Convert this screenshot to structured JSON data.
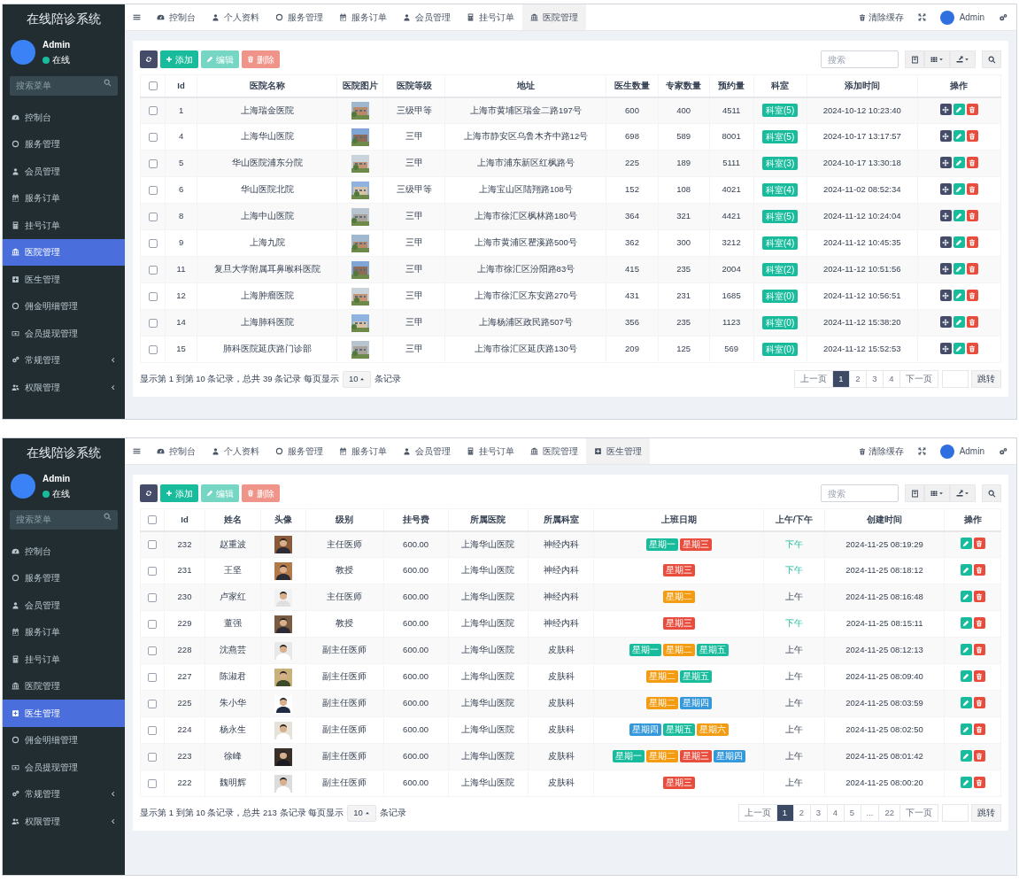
{
  "screens": [
    {
      "app_title": "在线陪诊系统",
      "user": {
        "name": "Admin",
        "status": "在线",
        "online": true
      },
      "menu_search": {
        "placeholder": "搜索菜单"
      },
      "menu": [
        {
          "kind": "dashboard",
          "label": "控制台",
          "selected": false
        },
        {
          "kind": "circle",
          "label": "服务管理",
          "selected": false
        },
        {
          "kind": "user",
          "label": "会员管理",
          "selected": false
        },
        {
          "kind": "calendar",
          "label": "服务订单",
          "selected": false
        },
        {
          "kind": "calculator",
          "label": "挂号订单",
          "selected": false
        },
        {
          "kind": "bank",
          "label": "医院管理",
          "selected": true
        },
        {
          "kind": "plus",
          "label": "医生管理",
          "selected": false
        },
        {
          "kind": "circle",
          "label": "佣金明细管理",
          "selected": false
        },
        {
          "kind": "money",
          "label": "会员提现管理",
          "selected": false
        },
        {
          "kind": "cogs",
          "label": "常规管理",
          "selected": false,
          "expandable": true
        },
        {
          "kind": "users",
          "label": "权限管理",
          "selected": false,
          "expandable": true
        }
      ],
      "tabs": [
        {
          "kind": "dashboard",
          "label": "控制台",
          "selected": false
        },
        {
          "kind": "user",
          "label": "个人资料",
          "selected": false
        },
        {
          "kind": "circle",
          "label": "服务管理",
          "selected": false
        },
        {
          "kind": "calendar",
          "label": "服务订单",
          "selected": false
        },
        {
          "kind": "user",
          "label": "会员管理",
          "selected": false
        },
        {
          "kind": "calculator",
          "label": "挂号订单",
          "selected": false
        },
        {
          "kind": "bank",
          "label": "医院管理",
          "selected": true
        }
      ],
      "header": {
        "clear_cache": "清除缓存",
        "user": "Admin"
      },
      "toolbar": [
        {
          "kind": "refresh",
          "disabled": false
        },
        {
          "kind": "add",
          "label": "添加",
          "disabled": false
        },
        {
          "kind": "edit",
          "label": "编辑",
          "disabled": true
        },
        {
          "kind": "delete",
          "label": "删除",
          "disabled": true
        }
      ],
      "search": {
        "placeholder": "搜索"
      },
      "table": {
        "kind": "hospitals",
        "select_all": {
          "checked": false
        },
        "columns": [
          {
            "label": "Id",
            "kind": "text"
          },
          {
            "label": "医院名称",
            "kind": "text"
          },
          {
            "label": "医院图片",
            "kind": "picture"
          },
          {
            "label": "医院等级",
            "kind": "text"
          },
          {
            "label": "地址",
            "kind": "text"
          },
          {
            "label": "医生数量",
            "kind": "text"
          },
          {
            "label": "专家数量",
            "kind": "text"
          },
          {
            "label": "预约量",
            "kind": "text"
          },
          {
            "label": "科室",
            "kind": "badge"
          },
          {
            "label": "添加时间",
            "kind": "text"
          },
          {
            "label": "操作",
            "kind": "actions"
          }
        ],
        "rows": [
          {
            "checked": false,
            "cells": [
              "1",
              "上海瑞金医院",
              {
                "kind": "picture"
              },
              "三级甲等",
              "上海市黄埔区瑞金二路197号",
              "600",
              "400",
              "4511",
              "科室(5)",
              "2024-10-12 10:23:40",
              [
                {
                  "kind": "move"
                },
                {
                  "kind": "edit"
                },
                {
                  "kind": "delete"
                }
              ]
            ]
          },
          {
            "checked": false,
            "cells": [
              "4",
              "上海华山医院",
              {
                "kind": "picture"
              },
              "三甲",
              "上海市静安区乌鲁木齐中路12号",
              "698",
              "589",
              "8001",
              "科室(5)",
              "2024-10-17 13:17:57",
              [
                {
                  "kind": "move"
                },
                {
                  "kind": "edit"
                },
                {
                  "kind": "delete"
                }
              ]
            ]
          },
          {
            "checked": false,
            "cells": [
              "5",
              "华山医院浦东分院",
              {
                "kind": "picture"
              },
              "三甲",
              "上海市浦东新区红枫路号",
              "225",
              "189",
              "5111",
              "科室(3)",
              "2024-10-17 13:30:18",
              [
                {
                  "kind": "move"
                },
                {
                  "kind": "edit"
                },
                {
                  "kind": "delete"
                }
              ]
            ]
          },
          {
            "checked": false,
            "cells": [
              "6",
              "华山医院北院",
              {
                "kind": "picture"
              },
              "三级甲等",
              "上海宝山区陆翔路108号",
              "152",
              "108",
              "4021",
              "科室(4)",
              "2024-11-02 08:52:34",
              [
                {
                  "kind": "move"
                },
                {
                  "kind": "edit"
                },
                {
                  "kind": "delete"
                }
              ]
            ]
          },
          {
            "checked": false,
            "cells": [
              "8",
              "上海中山医院",
              {
                "kind": "picture"
              },
              "三甲",
              "上海市徐汇区枫林路180号",
              "364",
              "321",
              "4421",
              "科室(5)",
              "2024-11-12 10:24:04",
              [
                {
                  "kind": "move"
                },
                {
                  "kind": "edit"
                },
                {
                  "kind": "delete"
                }
              ]
            ]
          },
          {
            "checked": false,
            "cells": [
              "9",
              "上海九院",
              {
                "kind": "picture"
              },
              "三甲",
              "上海市黄浦区瞿溪路500号",
              "362",
              "300",
              "3212",
              "科室(4)",
              "2024-11-12 10:45:35",
              [
                {
                  "kind": "move"
                },
                {
                  "kind": "edit"
                },
                {
                  "kind": "delete"
                }
              ]
            ]
          },
          {
            "checked": false,
            "cells": [
              "11",
              "复旦大学附属耳鼻喉科医院",
              {
                "kind": "picture"
              },
              "三甲",
              "上海市徐汇区汾阳路83号",
              "415",
              "235",
              "2004",
              "科室(2)",
              "2024-11-12 10:51:56",
              [
                {
                  "kind": "move"
                },
                {
                  "kind": "edit"
                },
                {
                  "kind": "delete"
                }
              ]
            ]
          },
          {
            "checked": false,
            "cells": [
              "12",
              "上海肿瘤医院",
              {
                "kind": "picture"
              },
              "三甲",
              "上海市徐汇区东安路270号",
              "431",
              "231",
              "1685",
              "科室(0)",
              "2024-11-12 10:56:51",
              [
                {
                  "kind": "move"
                },
                {
                  "kind": "edit"
                },
                {
                  "kind": "delete"
                }
              ]
            ]
          },
          {
            "checked": false,
            "cells": [
              "14",
              "上海肺科医院",
              {
                "kind": "picture"
              },
              "三甲",
              "上海杨浦区政民路507号",
              "356",
              "235",
              "1123",
              "科室(0)",
              "2024-11-12 15:38:20",
              [
                {
                  "kind": "move"
                },
                {
                  "kind": "edit"
                },
                {
                  "kind": "delete"
                }
              ]
            ]
          },
          {
            "checked": false,
            "cells": [
              "15",
              "肺科医院延庆路门诊部",
              {
                "kind": "picture"
              },
              "三甲",
              "上海市徐汇区延庆路130号",
              "209",
              "125",
              "569",
              "科室(0)",
              "2024-11-12 15:52:53",
              [
                {
                  "kind": "move"
                },
                {
                  "kind": "edit"
                },
                {
                  "kind": "delete"
                }
              ]
            ]
          }
        ]
      },
      "footer": {
        "summary": "显示第 1 到第 10 条记录，总共 39 条记录 每页显示",
        "page_size": "10",
        "suffix": "条记录"
      },
      "pagination": {
        "pages": [
          {
            "label": "上一页",
            "selected": false
          },
          {
            "label": "1",
            "selected": true
          },
          {
            "label": "2",
            "selected": false
          },
          {
            "label": "3",
            "selected": false
          },
          {
            "label": "4",
            "selected": false
          },
          {
            "label": "下一页",
            "selected": false
          }
        ],
        "jump": "跳转"
      }
    },
    {
      "app_title": "在线陪诊系统",
      "user": {
        "name": "Admin",
        "status": "在线",
        "online": true
      },
      "menu_search": {
        "placeholder": "搜索菜单"
      },
      "menu": [
        {
          "kind": "dashboard",
          "label": "控制台",
          "selected": false
        },
        {
          "kind": "circle",
          "label": "服务管理",
          "selected": false
        },
        {
          "kind": "user",
          "label": "会员管理",
          "selected": false
        },
        {
          "kind": "calendar",
          "label": "服务订单",
          "selected": false
        },
        {
          "kind": "calculator",
          "label": "挂号订单",
          "selected": false
        },
        {
          "kind": "bank",
          "label": "医院管理",
          "selected": false
        },
        {
          "kind": "plus",
          "label": "医生管理",
          "selected": true
        },
        {
          "kind": "circle",
          "label": "佣金明细管理",
          "selected": false
        },
        {
          "kind": "money",
          "label": "会员提现管理",
          "selected": false
        },
        {
          "kind": "cogs",
          "label": "常规管理",
          "selected": false,
          "expandable": true
        },
        {
          "kind": "users",
          "label": "权限管理",
          "selected": false,
          "expandable": true
        }
      ],
      "tabs": [
        {
          "kind": "dashboard",
          "label": "控制台",
          "selected": false
        },
        {
          "kind": "user",
          "label": "个人资料",
          "selected": false
        },
        {
          "kind": "circle",
          "label": "服务管理",
          "selected": false
        },
        {
          "kind": "calendar",
          "label": "服务订单",
          "selected": false
        },
        {
          "kind": "user",
          "label": "会员管理",
          "selected": false
        },
        {
          "kind": "calculator",
          "label": "挂号订单",
          "selected": false
        },
        {
          "kind": "bank",
          "label": "医院管理",
          "selected": false
        },
        {
          "kind": "plus",
          "label": "医生管理",
          "selected": true
        }
      ],
      "header": {
        "clear_cache": "清除缓存",
        "user": "Admin"
      },
      "toolbar": [
        {
          "kind": "refresh",
          "disabled": false
        },
        {
          "kind": "add",
          "label": "添加",
          "disabled": false
        },
        {
          "kind": "edit",
          "label": "编辑",
          "disabled": true
        },
        {
          "kind": "delete",
          "label": "删除",
          "disabled": true
        }
      ],
      "search": {
        "placeholder": "搜索"
      },
      "table": {
        "kind": "doctors",
        "select_all": {
          "checked": false
        },
        "columns": [
          {
            "label": "Id",
            "kind": "text"
          },
          {
            "label": "姓名",
            "kind": "text"
          },
          {
            "label": "头像",
            "kind": "picture"
          },
          {
            "label": "级别",
            "kind": "text"
          },
          {
            "label": "挂号费",
            "kind": "text"
          },
          {
            "label": "所属医院",
            "kind": "text"
          },
          {
            "label": "所属科室",
            "kind": "text"
          },
          {
            "label": "上班日期",
            "kind": "tags"
          },
          {
            "label": "上午/下午",
            "kind": "period"
          },
          {
            "label": "创建时间",
            "kind": "text"
          },
          {
            "label": "操作",
            "kind": "actions"
          }
        ],
        "rows": [
          {
            "checked": false,
            "cells": [
              "232",
              "赵重波",
              {
                "kind": "picture"
              },
              "主任医师",
              "600.00",
              "上海华山医院",
              "神经内科",
              [
                {
                  "text": "星期一",
                  "color": "#18bc9c"
                },
                {
                  "text": "星期三",
                  "color": "#e74c3c"
                }
              ],
              {
                "text": "下午",
                "afternoon": true
              },
              "2024-11-25 08:19:29",
              [
                {
                  "kind": "edit"
                },
                {
                  "kind": "delete"
                }
              ]
            ]
          },
          {
            "checked": false,
            "cells": [
              "231",
              "王坚",
              {
                "kind": "picture"
              },
              "教授",
              "600.00",
              "上海华山医院",
              "神经内科",
              [
                {
                  "text": "星期三",
                  "color": "#e74c3c"
                }
              ],
              {
                "text": "下午",
                "afternoon": true
              },
              "2024-11-25 08:18:12",
              [
                {
                  "kind": "edit"
                },
                {
                  "kind": "delete"
                }
              ]
            ]
          },
          {
            "checked": false,
            "cells": [
              "230",
              "卢家红",
              {
                "kind": "picture"
              },
              "主任医师",
              "600.00",
              "上海华山医院",
              "神经内科",
              [
                {
                  "text": "星期二",
                  "color": "#f39c12"
                }
              ],
              {
                "text": "上午",
                "afternoon": false
              },
              "2024-11-25 08:16:48",
              [
                {
                  "kind": "edit"
                },
                {
                  "kind": "delete"
                }
              ]
            ]
          },
          {
            "checked": false,
            "cells": [
              "229",
              "董强",
              {
                "kind": "picture"
              },
              "教授",
              "600.00",
              "上海华山医院",
              "神经内科",
              [
                {
                  "text": "星期三",
                  "color": "#e74c3c"
                }
              ],
              {
                "text": "下午",
                "afternoon": true
              },
              "2024-11-25 08:15:11",
              [
                {
                  "kind": "edit"
                },
                {
                  "kind": "delete"
                }
              ]
            ]
          },
          {
            "checked": false,
            "cells": [
              "228",
              "沈燕芸",
              {
                "kind": "picture"
              },
              "副主任医师",
              "600.00",
              "上海华山医院",
              "皮肤科",
              [
                {
                  "text": "星期一",
                  "color": "#18bc9c"
                },
                {
                  "text": "星期二",
                  "color": "#f39c12"
                },
                {
                  "text": "星期五",
                  "color": "#18bc9c"
                }
              ],
              {
                "text": "上午",
                "afternoon": false
              },
              "2024-11-25 08:12:13",
              [
                {
                  "kind": "edit"
                },
                {
                  "kind": "delete"
                }
              ]
            ]
          },
          {
            "checked": false,
            "cells": [
              "227",
              "陈淑君",
              {
                "kind": "picture"
              },
              "副主任医师",
              "600.00",
              "上海华山医院",
              "皮肤科",
              [
                {
                  "text": "星期二",
                  "color": "#f39c12"
                },
                {
                  "text": "星期五",
                  "color": "#18bc9c"
                }
              ],
              {
                "text": "上午",
                "afternoon": false
              },
              "2024-11-25 08:09:40",
              [
                {
                  "kind": "edit"
                },
                {
                  "kind": "delete"
                }
              ]
            ]
          },
          {
            "checked": false,
            "cells": [
              "225",
              "朱小华",
              {
                "kind": "picture"
              },
              "副主任医师",
              "600.00",
              "上海华山医院",
              "皮肤科",
              [
                {
                  "text": "星期二",
                  "color": "#f39c12"
                },
                {
                  "text": "星期四",
                  "color": "#3498db"
                }
              ],
              {
                "text": "上午",
                "afternoon": false
              },
              "2024-11-25 08:03:59",
              [
                {
                  "kind": "edit"
                },
                {
                  "kind": "delete"
                }
              ]
            ]
          },
          {
            "checked": false,
            "cells": [
              "224",
              "杨永生",
              {
                "kind": "picture"
              },
              "副主任医师",
              "600.00",
              "上海华山医院",
              "皮肤科",
              [
                {
                  "text": "星期四",
                  "color": "#3498db"
                },
                {
                  "text": "星期五",
                  "color": "#18bc9c"
                },
                {
                  "text": "星期六",
                  "color": "#f39c12"
                }
              ],
              {
                "text": "上午",
                "afternoon": false
              },
              "2024-11-25 08:02:50",
              [
                {
                  "kind": "edit"
                },
                {
                  "kind": "delete"
                }
              ]
            ]
          },
          {
            "checked": false,
            "cells": [
              "223",
              "徐峰",
              {
                "kind": "picture"
              },
              "副主任医师",
              "600.00",
              "上海华山医院",
              "皮肤科",
              [
                {
                  "text": "星期一",
                  "color": "#18bc9c"
                },
                {
                  "text": "星期二",
                  "color": "#f39c12"
                },
                {
                  "text": "星期三",
                  "color": "#e74c3c"
                },
                {
                  "text": "星期四",
                  "color": "#3498db"
                }
              ],
              {
                "text": "上午",
                "afternoon": false
              },
              "2024-11-25 08:01:42",
              [
                {
                  "kind": "edit"
                },
                {
                  "kind": "delete"
                }
              ]
            ]
          },
          {
            "checked": false,
            "cells": [
              "222",
              "魏明辉",
              {
                "kind": "picture"
              },
              "副主任医师",
              "600.00",
              "上海华山医院",
              "皮肤科",
              [
                {
                  "text": "星期三",
                  "color": "#e74c3c"
                }
              ],
              {
                "text": "上午",
                "afternoon": false
              },
              "2024-11-25 08:00:20",
              [
                {
                  "kind": "edit"
                },
                {
                  "kind": "delete"
                }
              ]
            ]
          }
        ]
      },
      "footer": {
        "summary": "显示第 1 到第 10 条记录，总共 213 条记录 每页显示",
        "page_size": "10",
        "suffix": "条记录"
      },
      "pagination": {
        "pages": [
          {
            "label": "上一页",
            "selected": false
          },
          {
            "label": "1",
            "selected": true
          },
          {
            "label": "2",
            "selected": false
          },
          {
            "label": "3",
            "selected": false
          },
          {
            "label": "4",
            "selected": false
          },
          {
            "label": "5",
            "selected": false
          },
          {
            "label": "...",
            "selected": false
          },
          {
            "label": "22",
            "selected": false
          },
          {
            "label": "下一页",
            "selected": false
          }
        ],
        "jump": "跳转"
      }
    }
  ]
}
